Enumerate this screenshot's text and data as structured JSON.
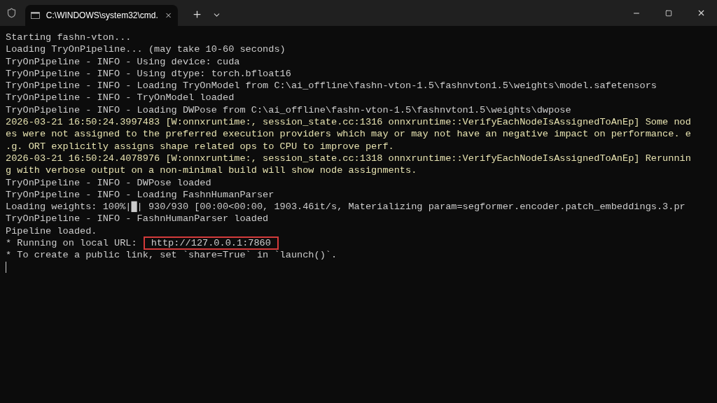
{
  "window": {
    "tabs": [
      {
        "title": "C:\\WINDOWS\\system32\\cmd.",
        "selected": true
      }
    ]
  },
  "terminal": {
    "lines": [
      {
        "kind": "plain",
        "text": "Starting fashn-vton..."
      },
      {
        "kind": "plain",
        "text": "Loading TryOnPipeline... (may take 10-60 seconds)"
      },
      {
        "kind": "plain",
        "text": "TryOnPipeline - INFO - Using device: cuda"
      },
      {
        "kind": "plain",
        "text": "TryOnPipeline - INFO - Using dtype: torch.bfloat16"
      },
      {
        "kind": "plain",
        "text": "TryOnPipeline - INFO - Loading TryOnModel from C:\\ai_offline\\fashn-vton-1.5\\fashnvton1.5\\weights\\model.safetensors"
      },
      {
        "kind": "plain",
        "text": "TryOnPipeline - INFO - TryOnModel loaded"
      },
      {
        "kind": "plain",
        "text": "TryOnPipeline - INFO - Loading DWPose from C:\\ai_offline\\fashn-vton-1.5\\fashnvton1.5\\weights\\dwpose"
      },
      {
        "kind": "warning",
        "text": "2026-03-21 16:50:24.3997483 [W:onnxruntime:, session_state.cc:1316 onnxruntime::VerifyEachNodeIsAssignedToAnEp] Some nod"
      },
      {
        "kind": "warning",
        "text": "es were not assigned to the preferred execution providers which may or may not have an negative impact on performance. e"
      },
      {
        "kind": "warning",
        "text": ".g. ORT explicitly assigns shape related ops to CPU to improve perf."
      },
      {
        "kind": "warning",
        "text": "2026-03-21 16:50:24.4078976 [W:onnxruntime:, session_state.cc:1318 onnxruntime::VerifyEachNodeIsAssignedToAnEp] Rerunnin"
      },
      {
        "kind": "warning",
        "text": "g with verbose output on a non-minimal build will show node assignments."
      },
      {
        "kind": "plain",
        "text": "TryOnPipeline - INFO - DWPose loaded"
      },
      {
        "kind": "plain",
        "text": "TryOnPipeline - INFO - Loading FashnHumanParser"
      },
      {
        "kind": "plain",
        "text": "Loading weights: 100%|█| 930/930 [00:00<00:00, 1903.46it/s, Materializing param=segformer.encoder.patch_embeddings.3.pr"
      },
      {
        "kind": "plain",
        "text": "TryOnPipeline - INFO - FashnHumanParser loaded"
      },
      {
        "kind": "plain",
        "text": "Pipeline loaded."
      },
      {
        "kind": "url",
        "text": "* Running on local URL:",
        "url": "http://127.0.0.1:7860"
      },
      {
        "kind": "plain",
        "text": "* To create a public link, set `share=True` in `launch()`."
      }
    ]
  }
}
